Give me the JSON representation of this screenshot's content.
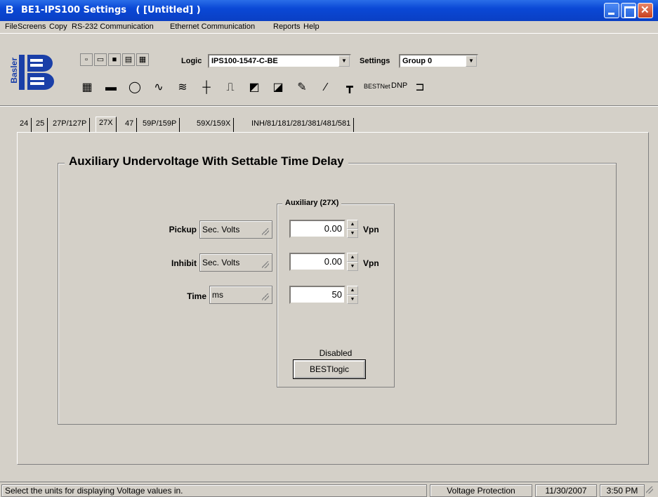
{
  "window": {
    "title": "BE1-IPS100 Settings   ( [Untitled] )",
    "colors": {
      "titlebar": "#0a48d6",
      "face": "#d4d0c8"
    }
  },
  "menu": [
    "File",
    "Screens",
    "Copy",
    "RS-232 Communication",
    "Ethernet Communication",
    "Reports",
    "Help"
  ],
  "toolbar": {
    "logo_text": "Basler",
    "logic_label": "Logic",
    "logic_value": "IPS100-1547-C-BE",
    "settings_label": "Settings",
    "settings_value": "Group 0",
    "bestnet_label": "BESTNet",
    "dnp_label": "DNP"
  },
  "tabs": [
    "24",
    "25",
    "27P/127P",
    "27X",
    "47",
    "59P/159P",
    "59X/159X",
    "INH/81/181/281/381/481/581"
  ],
  "active_tab": "27X",
  "panel": {
    "title": "Auxiliary Undervoltage With Settable Time Delay",
    "aux_title": "Auxiliary (27X)",
    "rows": [
      {
        "label": "Pickup",
        "unit_select": "Sec. Volts",
        "value": "0.00",
        "unit": "Vpn"
      },
      {
        "label": "Inhibit",
        "unit_select": "Sec. Volts",
        "value": "0.00",
        "unit": "Vpn"
      },
      {
        "label": "Time",
        "unit_select": "ms",
        "value": "50",
        "unit": ""
      }
    ],
    "status_text": "Disabled",
    "bestlogic_label": "BESTlogic"
  },
  "statusbar": {
    "message": "Select the units for displaying Voltage values in.",
    "section": "Voltage Protection",
    "date": "11/30/2007",
    "time": "3:50 PM"
  }
}
